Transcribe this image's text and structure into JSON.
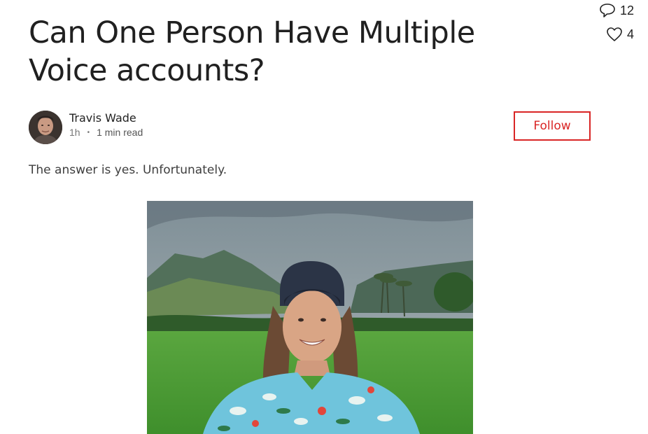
{
  "article": {
    "title": "Can One Person Have Multiple Voice accounts?",
    "lead": "The answer is yes. Unfortunately."
  },
  "stats": {
    "comments": "12",
    "likes": "4",
    "comment_icon": "speech-bubble-icon",
    "like_icon": "heart-outline-icon"
  },
  "author": {
    "name": "Travis Wade",
    "time": "1h",
    "separator": "•",
    "read_time": "1 min read",
    "follow_label": "Follow"
  },
  "colors": {
    "accent": "#d92525",
    "title": "#202020",
    "meta": "#777777"
  }
}
